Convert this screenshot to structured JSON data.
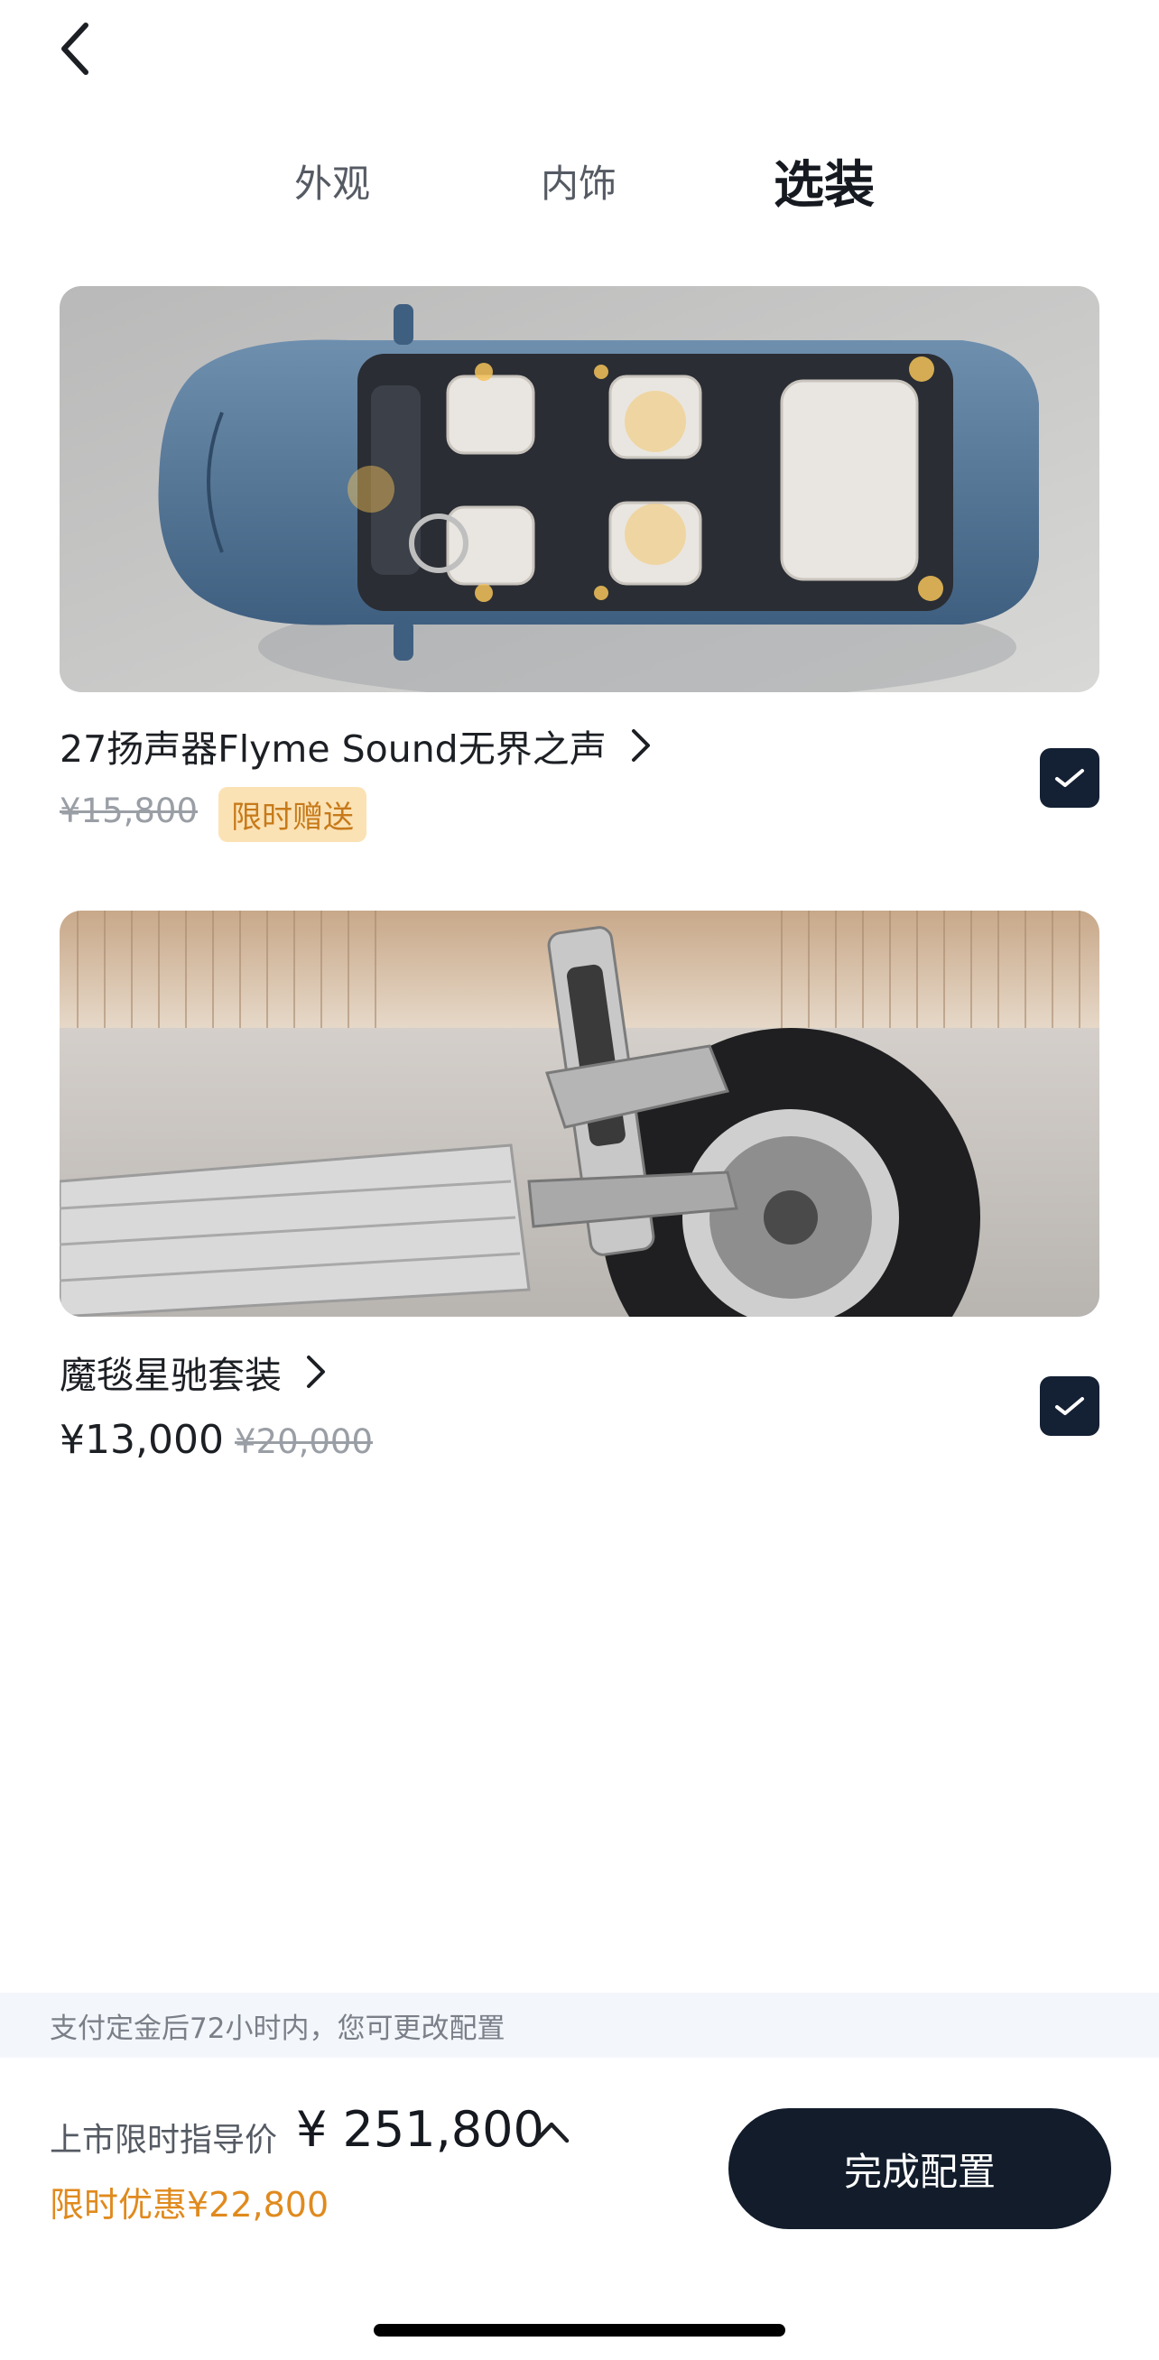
{
  "tabs": [
    {
      "label": "外观",
      "active": false
    },
    {
      "label": "内饰",
      "active": false
    },
    {
      "label": "选装",
      "active": true
    }
  ],
  "options": [
    {
      "title": "27扬声器Flyme Sound无界之声",
      "original_price": "¥15,800",
      "badge": "限时赠送",
      "checked": true,
      "image": "car-interior-speakers-top-view"
    },
    {
      "title": "魔毯星驰套装",
      "price": "¥13,000",
      "original_price": "¥20,000",
      "checked": true,
      "image": "suspension-chassis-wheel"
    }
  ],
  "notice": "支付定金后72小时内，您可更改配置",
  "footer": {
    "price_label": "上市限时指导价",
    "total_price": "¥ 251,800",
    "discount": "限时优惠¥22,800",
    "confirm_label": "完成配置"
  },
  "colors": {
    "dark_navy": "#121c2b",
    "accent_orange": "#e08a1e",
    "badge_bg": "#fbe2b4",
    "notice_bg": "#f3f6fb"
  },
  "icons": [
    "back-chevron-icon",
    "chevron-right-icon",
    "check-icon",
    "chevron-up-icon"
  ]
}
